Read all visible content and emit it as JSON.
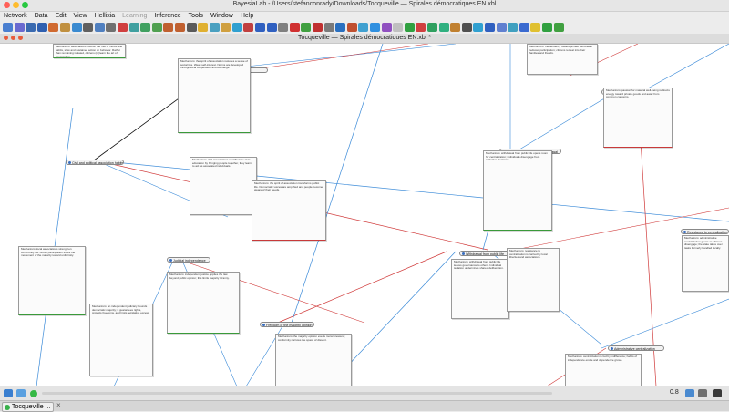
{
  "window": {
    "title": "BayesiaLab - /Users/stefanconrady/Downloads/Tocqueville — Spirales démocratiques EN.xbl"
  },
  "menus": [
    {
      "label": "Network",
      "disabled": false
    },
    {
      "label": "Data",
      "disabled": false
    },
    {
      "label": "Edit",
      "disabled": false
    },
    {
      "label": "View",
      "disabled": false
    },
    {
      "label": "Hellixia",
      "disabled": false
    },
    {
      "label": "Learning",
      "disabled": true
    },
    {
      "label": "Inference",
      "disabled": false
    },
    {
      "label": "Tools",
      "disabled": false
    },
    {
      "label": "Window",
      "disabled": false
    },
    {
      "label": "Help",
      "disabled": false
    }
  ],
  "toolbar": {
    "buttons": [
      {
        "icon": "home-icon",
        "color": "#4a7fd0"
      },
      {
        "icon": "new-file-icon",
        "color": "#6a6ad0"
      },
      {
        "icon": "open-folder-icon",
        "color": "#3a6ab0"
      },
      {
        "icon": "save-icon",
        "color": "#3060b0"
      },
      {
        "icon": "database-icon",
        "color": "#d06a30"
      },
      {
        "icon": "print-icon",
        "color": "#c09040"
      },
      {
        "icon": "chart-icon",
        "color": "#3a8ad0"
      },
      {
        "icon": "table-icon",
        "color": "#606060"
      },
      {
        "icon": "search-icon",
        "color": "#5080c0"
      },
      {
        "icon": "gear-icon",
        "color": "#707070"
      },
      {
        "icon": "select-arrow-icon",
        "color": "#d04040"
      },
      {
        "icon": "cut-icon",
        "color": "#40a0a0"
      },
      {
        "icon": "copy-icon",
        "color": "#40a060"
      },
      {
        "icon": "paste-icon",
        "color": "#50a050"
      },
      {
        "icon": "undo-icon",
        "color": "#c06030"
      },
      {
        "icon": "redo-icon",
        "color": "#c06030"
      },
      {
        "icon": "layout-icon",
        "color": "#5a5a5a"
      },
      {
        "icon": "hand-icon",
        "color": "#e0b030"
      },
      {
        "icon": "node-icon",
        "color": "#4aa0c0"
      },
      {
        "icon": "monitor-icon",
        "color": "#d0a040"
      },
      {
        "icon": "network-icon",
        "color": "#30a0d0"
      },
      {
        "icon": "graph-icon",
        "color": "#c04040"
      },
      {
        "icon": "zoom-in-icon",
        "color": "#3060c0"
      },
      {
        "icon": "zoom-out-icon",
        "color": "#3060c0"
      },
      {
        "icon": "link-icon",
        "color": "#808080"
      },
      {
        "icon": "arc-icon",
        "color": "#d03030"
      },
      {
        "icon": "fit-icon",
        "color": "#40a040"
      },
      {
        "icon": "cross-icon",
        "color": "#c03030"
      },
      {
        "icon": "rectangle-icon",
        "color": "#7a7a7a"
      },
      {
        "icon": "node-add-icon",
        "color": "#2a70c0"
      },
      {
        "icon": "arc-add-icon",
        "color": "#c05030"
      },
      {
        "icon": "report-icon",
        "color": "#40a0d0"
      },
      {
        "icon": "circle-icon",
        "color": "#3090e0"
      },
      {
        "icon": "target-icon",
        "color": "#9050c0"
      },
      {
        "icon": "square-icon",
        "color": "#c0c0c0"
      },
      {
        "icon": "constraint-icon",
        "color": "#30a040"
      },
      {
        "icon": "forbidden-icon",
        "color": "#d04040"
      },
      {
        "icon": "clock-icon",
        "color": "#30a060"
      },
      {
        "icon": "tree-icon",
        "color": "#30b080"
      },
      {
        "icon": "graph-edit-icon",
        "color": "#c08030"
      },
      {
        "icon": "cursor-icon",
        "color": "#505050"
      },
      {
        "icon": "classes-icon",
        "color": "#30a0d0"
      },
      {
        "icon": "dot-icon",
        "color": "#3060c0"
      },
      {
        "icon": "diamond-icon",
        "color": "#6080d0"
      },
      {
        "icon": "octagon-icon",
        "color": "#40a0c0"
      },
      {
        "icon": "cluster-icon",
        "color": "#3a6ad0"
      },
      {
        "icon": "note-icon",
        "color": "#e0c030"
      },
      {
        "icon": "comment-icon",
        "color": "#30a040"
      },
      {
        "icon": "trash-icon",
        "color": "#40a040"
      }
    ]
  },
  "document": {
    "tab_title": "Tocqueville — Spirales démocratiques EN.xbl *"
  },
  "nodes": [
    {
      "label": "Norm-influencing association",
      "name": "node-norm-influencing-association"
    },
    {
      "label": "Civil and political association habits",
      "name": "node-civil-political-association-habits"
    },
    {
      "label": "Judicial independence",
      "name": "node-judicial-independence"
    },
    {
      "label": "Freedom of the majority opinion",
      "name": "node-freedom-majority-opinion"
    },
    {
      "label": "Tendency toward private withdrawal",
      "name": "node-tendency-private-withdrawal"
    },
    {
      "label": "Passion for material well-being",
      "name": "node-passion-material-well-being"
    },
    {
      "label": "Withdrawal from public life",
      "name": "node-withdrawal-public-life"
    },
    {
      "label": "Resistance to centralization",
      "name": "node-resistance-centralization"
    },
    {
      "label": "Administrative centralization",
      "name": "node-administrative-centralization"
    }
  ],
  "notes": [
    {
      "text": "Mechanism: associations nourish the rise of mores and habits, slow and sustained action on behavior. Rather than remaining isolated, citizens (re)learn the art of cooperation."
    },
    {
      "text": "Mechanism: the spirit of association restores a sense of social ties. Weak self-interest. Norms are developed through local cooperation and exchange."
    },
    {
      "text": "Mechanism: civil associations contribute to civic education by bringing people together, they learn to act as associated individuals."
    },
    {
      "text": "Mechanism: the spirit of association transforms public life. Democratic voices are amplified and people become aware of their needs."
    },
    {
      "text": "Mechanism: local associations strengthen community life. Active participation slows the movement of the majority toward uniformity."
    },
    {
      "text": "Mechanism: an independent judiciary bounds democratic majority; it guarantees rights, protects freedoms, and limits legislative excess."
    },
    {
      "text": "Mechanism: independent justice applies the law beyond public opinion; this limits majority tyranny."
    },
    {
      "text": "Mechanism: the majority opinion exerts moral pressure; conformity narrows the space of dissent."
    },
    {
      "text": "Mechanism: the tendency toward private withdrawal reduces participation; citizens retreat into their families and friends."
    },
    {
      "text": "Mechanism: passion for material well-being redirects energy toward private goods and away from common concerns."
    },
    {
      "text": "Mechanism: withdrawal from public life opens room for centralization; individuals disengage from collective decisions."
    },
    {
      "text": "Mechanism: withdrawal from public life leaves governance to others. Individual isolation undermines shared deliberation."
    },
    {
      "text": "Mechanism: resistance to centralization is carried by local liberties and associations."
    },
    {
      "text": "Mechanism: administrative centralization grows as citizens disengage; the state takes over tasks formerly handled locally."
    },
    {
      "text": "Mechanism: centralization is fed by indifference; habits of independence erode and dependence grows."
    }
  ],
  "status": {
    "progress": 0.0,
    "zoom_label": "0.8"
  },
  "taskbar": {
    "app_label": "Tocqueville ...",
    "close_label": "×"
  }
}
